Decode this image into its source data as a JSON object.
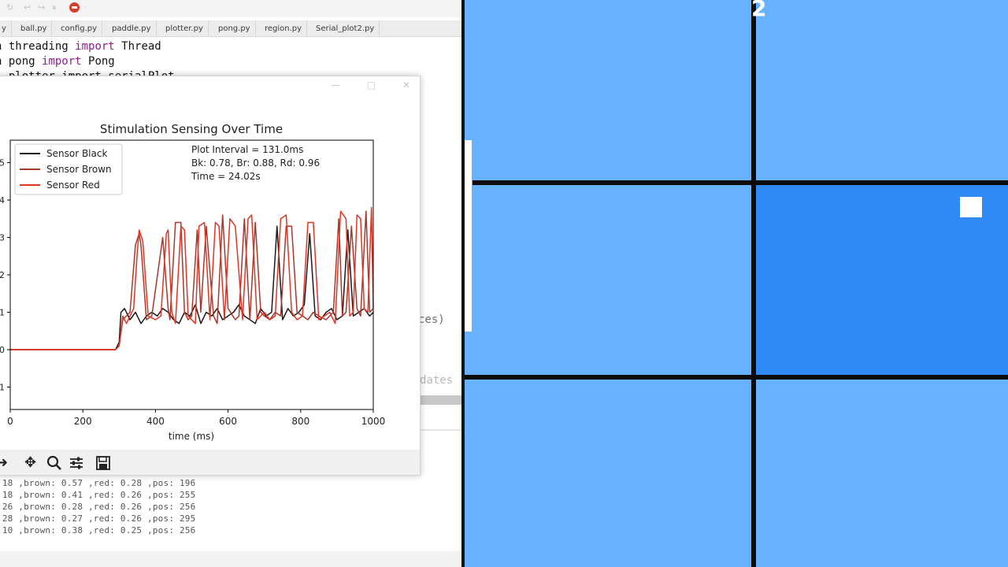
{
  "ide": {
    "topbar": {
      "icons": [
        "↻",
        "↩",
        "↪",
        "⏸"
      ]
    },
    "tabs": [
      "y",
      "ball.py",
      "config.py",
      "paddle.py",
      "plotter.py",
      "pong.py",
      "region.py",
      "Serial_plot2.py"
    ],
    "code": {
      "line1": {
        "pre": "n threading ",
        "kw": "import",
        "post": " Thread"
      },
      "line2": {
        "pre": "n pong ",
        "kw": "import",
        "post": " Pong"
      },
      "line3": "  plotter import serialPlot"
    },
    "partial_text": {
      "ces": "ces)",
      "dates": "dates |"
    },
    "console_lines": [
      ".18 ,brown: 0.57 ,red: 0.28 ,pos: 196",
      ".18 ,brown: 0.41 ,red: 0.26 ,pos: 255",
      ".26 ,brown: 0.28 ,red: 0.26 ,pos: 256",
      ".28 ,brown: 0.27 ,red: 0.26 ,pos: 295",
      ".10 ,brown: 0.38 ,red: 0.25 ,pos: 256"
    ]
  },
  "plot_window": {
    "controls": {
      "minimize": "—",
      "maximize": "□",
      "close": "✕"
    },
    "toolbar_icons": [
      "arrow-right-icon",
      "move-icon",
      "zoom-icon",
      "configure-icon",
      "save-icon"
    ]
  },
  "chart_data": {
    "type": "line",
    "title": "Stimulation Sensing Over Time",
    "xlabel": "time (ms)",
    "ylabel": "",
    "xlim": [
      0,
      1000
    ],
    "ylim": [
      -1.6,
      5.6
    ],
    "xticks": [
      0,
      200,
      400,
      600,
      800,
      1000
    ],
    "yticks": [
      -1,
      0,
      1,
      2,
      3,
      4,
      5
    ],
    "ytick_labels": [
      "1",
      "0",
      "1",
      "2",
      "3",
      "4",
      "5"
    ],
    "grid": false,
    "legend_position": "top-left",
    "annotations": [
      "Plot Interval = 131.0ms",
      "Bk: 0.78, Br: 0.88, Rd: 0.96",
      "Time = 24.02s"
    ],
    "series": [
      {
        "name": "Sensor Black",
        "color": "#1a1a1a",
        "x": [
          0,
          290,
          300,
          305,
          315,
          330,
          345,
          360,
          375,
          390,
          405,
          420,
          435,
          450,
          465,
          480,
          495,
          510,
          525,
          540,
          555,
          570,
          585,
          600,
          615,
          630,
          645,
          660,
          675,
          690,
          705,
          720,
          735,
          750,
          765,
          780,
          795,
          810,
          825,
          840,
          855,
          870,
          885,
          900,
          915,
          930,
          945,
          960,
          975,
          990,
          1000
        ],
        "y": [
          0,
          0,
          0.2,
          1.0,
          1.1,
          0.8,
          1.0,
          0.7,
          0.9,
          1.0,
          0.9,
          1.1,
          1.0,
          0.8,
          0.7,
          1.0,
          0.9,
          1.2,
          0.7,
          1.0,
          0.9,
          1.1,
          0.8,
          0.9,
          1.0,
          1.2,
          0.9,
          0.8,
          0.7,
          1.1,
          0.9,
          1.0,
          3.3,
          0.8,
          1.1,
          0.9,
          1.0,
          1.2,
          3.1,
          0.9,
          0.8,
          1.0,
          1.1,
          0.8,
          0.9,
          3.2,
          0.9,
          1.0,
          1.1,
          0.9,
          1.0
        ]
      },
      {
        "name": "Sensor Brown",
        "color": "#a8372b",
        "x": [
          0,
          290,
          300,
          310,
          330,
          345,
          355,
          360,
          375,
          390,
          420,
          435,
          440,
          455,
          470,
          480,
          490,
          500,
          515,
          525,
          540,
          560,
          570,
          585,
          600,
          620,
          630,
          645,
          660,
          675,
          690,
          700,
          715,
          730,
          745,
          760,
          775,
          790,
          805,
          820,
          835,
          850,
          870,
          890,
          905,
          915,
          925,
          940,
          955,
          965,
          980,
          990,
          1000
        ],
        "y": [
          0,
          0,
          0.1,
          0.8,
          1.0,
          2.8,
          3.1,
          2.8,
          0.8,
          0.9,
          3.0,
          1.1,
          0.8,
          3.4,
          3.4,
          1.0,
          0.8,
          0.9,
          3.2,
          1.0,
          3.3,
          0.9,
          0.7,
          3.6,
          1.1,
          0.8,
          0.9,
          3.5,
          0.8,
          3.4,
          1.0,
          0.9,
          0.8,
          1.0,
          0.9,
          3.3,
          3.3,
          1.0,
          0.9,
          0.8,
          1.0,
          0.9,
          0.8,
          1.0,
          3.5,
          0.9,
          1.0,
          3.3,
          1.1,
          0.9,
          3.7,
          1.0,
          1.1
        ]
      },
      {
        "name": "Sensor Red",
        "color": "#e03525",
        "x": [
          0,
          290,
          300,
          310,
          320,
          340,
          350,
          355,
          365,
          380,
          400,
          415,
          430,
          435,
          445,
          455,
          470,
          480,
          490,
          510,
          520,
          535,
          550,
          565,
          575,
          590,
          605,
          620,
          640,
          655,
          665,
          680,
          700,
          715,
          730,
          745,
          760,
          775,
          790,
          805,
          820,
          835,
          850,
          865,
          880,
          895,
          910,
          925,
          935,
          945,
          955,
          965,
          975,
          985,
          995,
          1000
        ],
        "y": [
          0,
          0,
          0.1,
          0.9,
          0.7,
          1.1,
          2.6,
          3.2,
          2.9,
          0.9,
          0.8,
          0.9,
          3.1,
          3.2,
          1.0,
          0.7,
          3.3,
          3.2,
          0.9,
          0.7,
          3.3,
          3.4,
          0.8,
          3.4,
          3.3,
          0.8,
          3.5,
          3.3,
          0.8,
          3.5,
          3.6,
          0.8,
          1.0,
          0.8,
          0.9,
          3.5,
          3.6,
          1.0,
          0.8,
          0.9,
          3.4,
          3.4,
          0.8,
          0.9,
          1.0,
          0.7,
          3.7,
          3.5,
          0.9,
          1.0,
          3.6,
          3.5,
          1.1,
          1.0,
          3.8,
          1.1
        ]
      }
    ]
  },
  "pong": {
    "score": "2",
    "colors": {
      "field": "#66b2ff",
      "active_region": "#2f8af5",
      "grid": "#0c0c0c"
    }
  }
}
